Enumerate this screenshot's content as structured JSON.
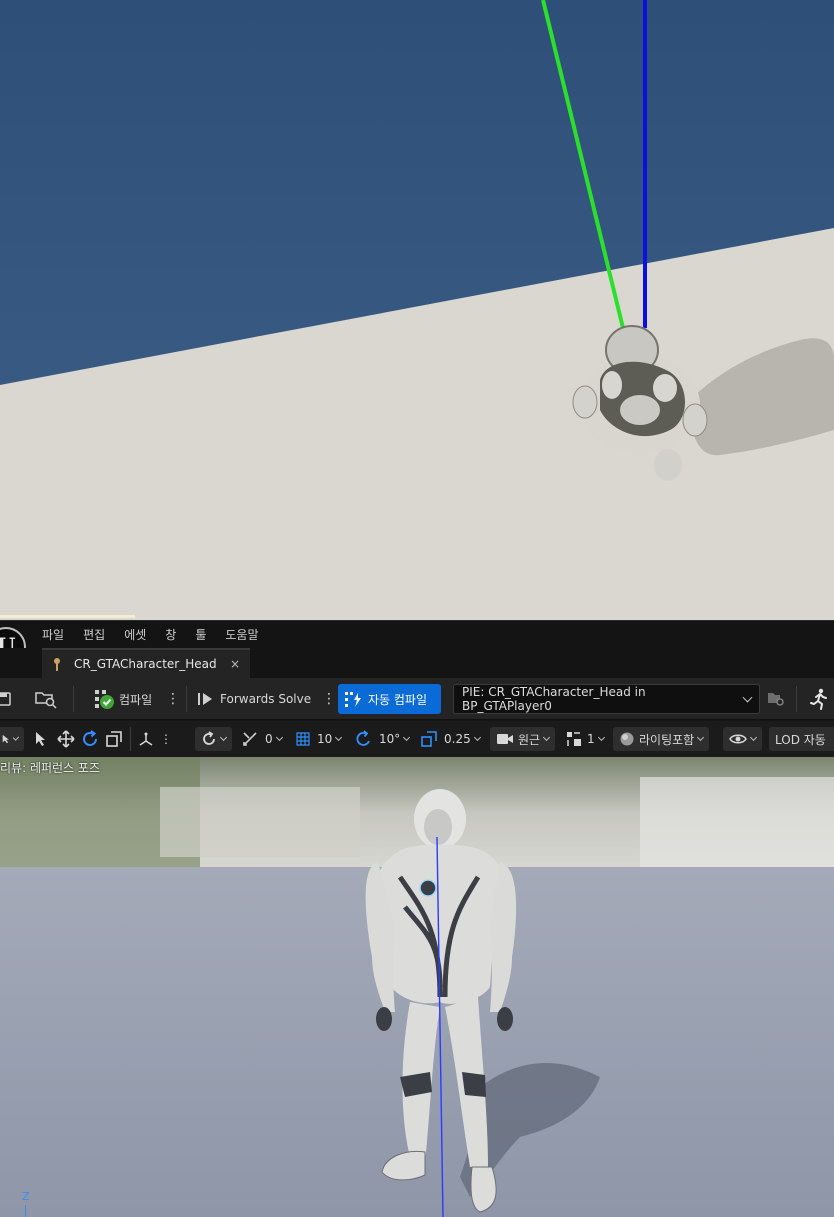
{
  "menu": {
    "items": [
      "파일",
      "편집",
      "에셋",
      "창",
      "툴",
      "도움말"
    ]
  },
  "tab": {
    "title": "CR_GTACharacter_Head",
    "close_glyph": "×"
  },
  "toolbar": {
    "compile_label": "컴파일",
    "forwards_solve_label": "Forwards Solve",
    "auto_compile_label": "자동 컴파일",
    "pie_label": "PIE: CR_GTACharacter_Head in BP_GTAPlayer0"
  },
  "viewport_toolbar": {
    "rotation_snap": "0",
    "grid_snap": "10",
    "angle_snap": "10°",
    "scale_snap": "0.25",
    "camera_label": "원근",
    "screen_count": "1",
    "lighting_label": "라이팅포함",
    "lod_label": "LOD 자동"
  },
  "preview": {
    "mode_label": "리뷰: 레퍼런스 포즈",
    "axis_label": "Z"
  },
  "colors": {
    "accent": "#0a6bd6",
    "sky": "#3d5c82",
    "floor": "#d9d6d0",
    "preview_floor": "#9aa2b0"
  }
}
